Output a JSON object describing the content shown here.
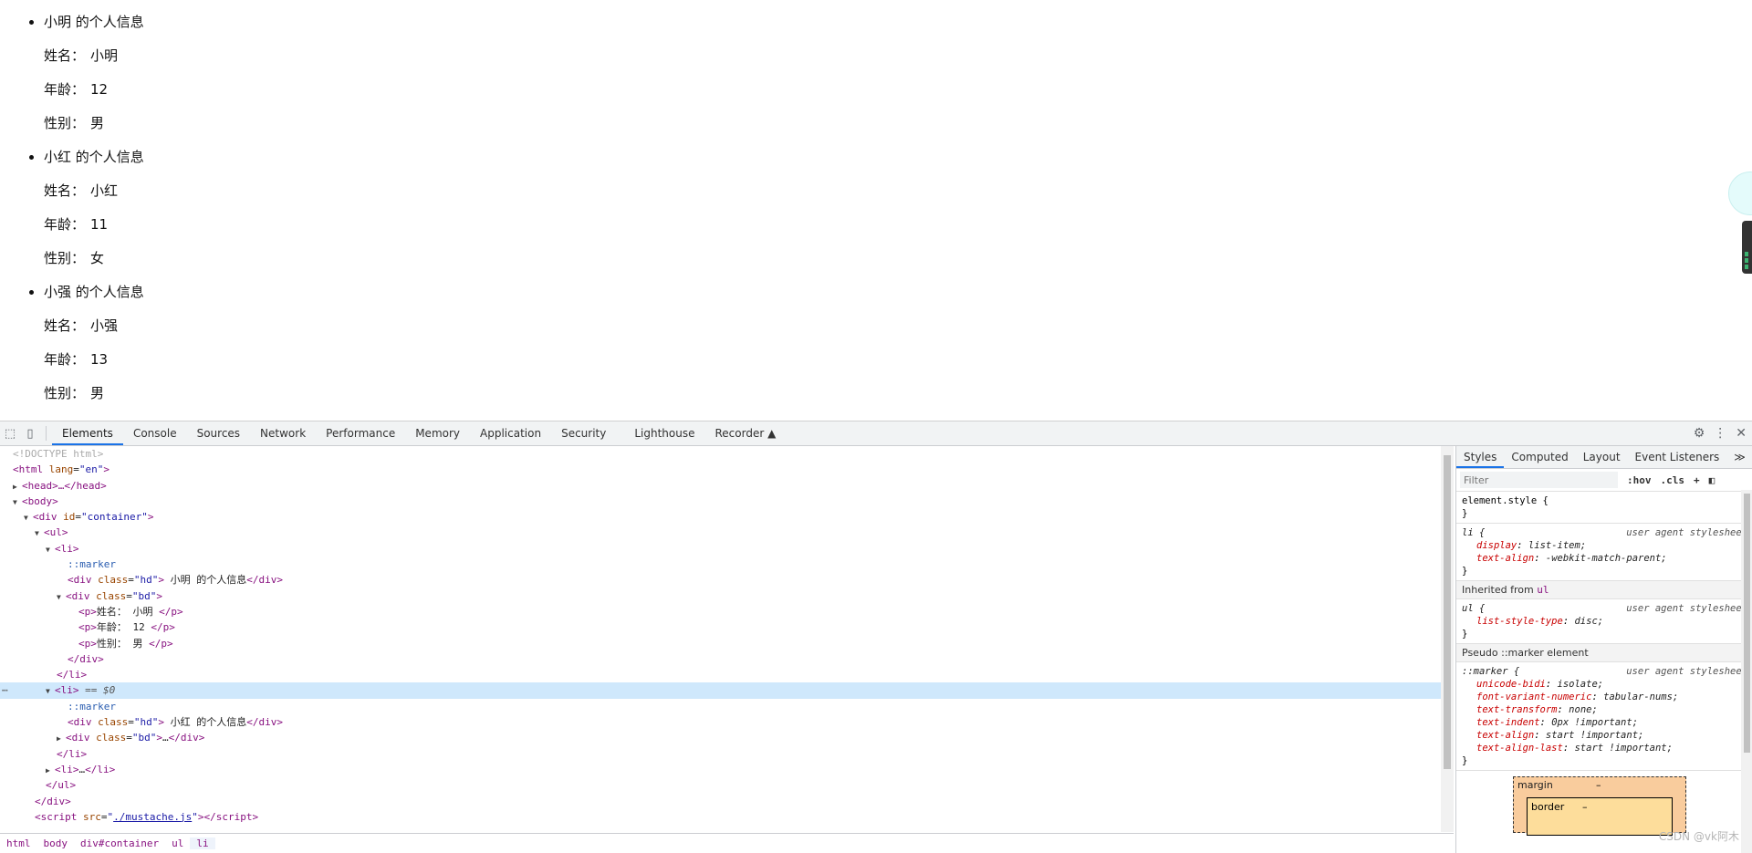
{
  "page": {
    "people": [
      {
        "header": "小明 的个人信息",
        "fields": [
          {
            "label": "姓名：",
            "value": "小明"
          },
          {
            "label": "年龄：",
            "value": "12"
          },
          {
            "label": "性别：",
            "value": "男"
          }
        ]
      },
      {
        "header": "小红 的个人信息",
        "fields": [
          {
            "label": "姓名：",
            "value": "小红"
          },
          {
            "label": "年龄：",
            "value": "11"
          },
          {
            "label": "性别：",
            "value": "女"
          }
        ]
      },
      {
        "header": "小强 的个人信息",
        "fields": [
          {
            "label": "姓名：",
            "value": "小强"
          },
          {
            "label": "年龄：",
            "value": "13"
          },
          {
            "label": "性别：",
            "value": "男"
          }
        ]
      }
    ]
  },
  "devtools": {
    "tabs": [
      "Elements",
      "Console",
      "Sources",
      "Network",
      "Performance",
      "Memory",
      "Application",
      "Security",
      "Lighthouse",
      "Recorder ▲"
    ],
    "active_tab": "Elements",
    "dom": {
      "doctype": "<!DOCTYPE html>",
      "html_tag": "html",
      "lang_attr": "lang",
      "lang_val": "\"en\"",
      "head_collapsed": "<head>…</head>",
      "body_tag": "body",
      "div_tag": "div",
      "id_attr": "id",
      "container_val": "\"container\"",
      "ul_tag": "ul",
      "li_tag": "li",
      "marker": "::marker",
      "class_attr": "class",
      "hd_val": "\"hd\"",
      "bd_val": "\"bd\"",
      "hd1_text": " 小明 的个人信息",
      "p1": "姓名： 小明 ",
      "p2": "年龄： 12 ",
      "p3": "性别： 男 ",
      "selected_suffix": " == $0",
      "hd2_text": " 小红 的个人信息",
      "bd_collapsed": "…",
      "li_collapsed": "…",
      "script_tag": "script",
      "src_attr": "src",
      "script_src": "./mustache.js",
      "dots": "⋯"
    },
    "breadcrumb": [
      "html",
      "body",
      "div#container",
      "ul",
      "li"
    ],
    "styles_tabs": [
      "Styles",
      "Computed",
      "Layout",
      "Event Listeners",
      "≫"
    ],
    "filter_placeholder": "Filter",
    "filter_buttons": [
      ":hov",
      ".cls",
      "+"
    ],
    "rules": {
      "element_style_open": "element.style {",
      "close": "}",
      "li_selector": "li {",
      "ua": "user agent stylesheet",
      "li_props": [
        {
          "n": "display",
          "v": "list-item;"
        },
        {
          "n": "text-align",
          "v": "-webkit-match-parent;"
        }
      ],
      "inherited_label": "Inherited from ",
      "inherited_tag": "ul",
      "ul_selector": "ul {",
      "ul_props": [
        {
          "n": "list-style-type",
          "v": "disc;"
        }
      ],
      "pseudo_label": "Pseudo ::marker element",
      "marker_selector": "::marker {",
      "marker_props": [
        {
          "n": "unicode-bidi",
          "v": "isolate;"
        },
        {
          "n": "font-variant-numeric",
          "v": "tabular-nums;"
        },
        {
          "n": "text-transform",
          "v": "none;"
        },
        {
          "n": "text-indent",
          "v": "0px !important;"
        },
        {
          "n": "text-align",
          "v": "start !important;"
        },
        {
          "n": "text-align-last",
          "v": "start !important;"
        }
      ]
    },
    "box_model": {
      "margin_label": "margin",
      "margin_value": "–",
      "border_label": "border",
      "border_value": "–"
    },
    "watermark": "CSDN @vk阿木"
  }
}
